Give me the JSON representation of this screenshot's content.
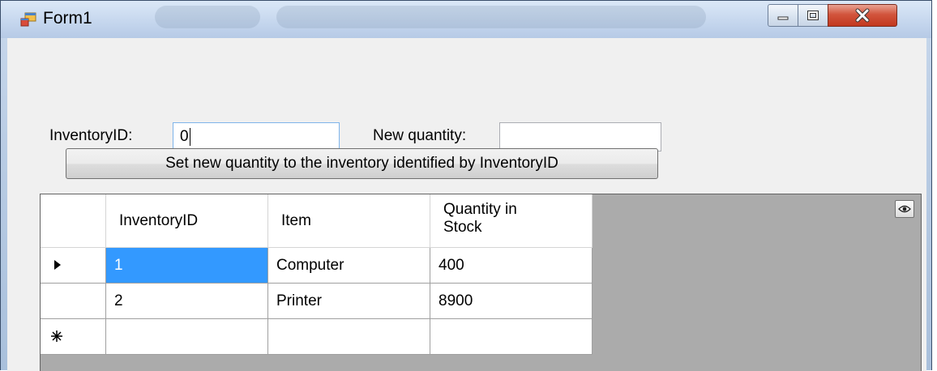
{
  "window": {
    "title": "Form1"
  },
  "form": {
    "inventory_id_label": "InventoryID:",
    "inventory_id_value": "0",
    "new_quantity_label": "New quantity:",
    "new_quantity_value": "",
    "set_button_label": "Set new quantity to the inventory identified by InventoryID"
  },
  "grid": {
    "columns": [
      "InventoryID",
      "Item",
      "Quantity in\nStock"
    ],
    "rows": [
      {
        "indicator": "current-row-arrow",
        "cells": [
          "1",
          "Computer",
          "400"
        ]
      },
      {
        "indicator": "",
        "cells": [
          "2",
          "Printer",
          "8900"
        ]
      },
      {
        "indicator": "new-row-asterisk",
        "cells": [
          "",
          "",
          ""
        ]
      }
    ]
  },
  "colors": {
    "selection": "#3399ff",
    "grid_background": "#ababab",
    "close_button": "#c2381f"
  }
}
